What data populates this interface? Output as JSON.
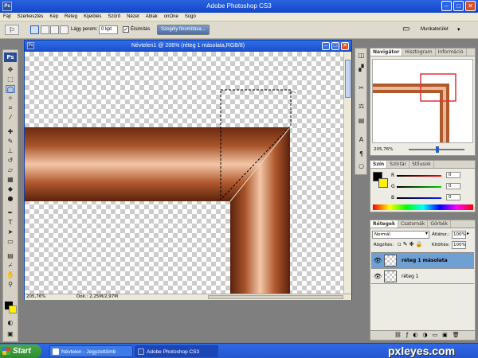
{
  "app": {
    "title": "Adobe Photoshop CS3",
    "ps_badge": "Ps"
  },
  "menu": [
    "Fájl",
    "Szerkesztés",
    "Kép",
    "Réteg",
    "Kijelölés",
    "Szűrő",
    "Nézet",
    "Ablak",
    "onOne",
    "Súgó"
  ],
  "options": {
    "feather_label": "Lágy perem:",
    "feather_value": "0 kpt",
    "antialias_label": "Élsimítás",
    "refine_button": "Szegély finomítása...",
    "workspace_label": "Munkaterület"
  },
  "document": {
    "title": "Névtelen1 @ 206% (réteg 1 másolata,RGB/8)",
    "zoom": "205,76%",
    "doc_info": "Dok.: 2,25M/2,97M"
  },
  "navigator": {
    "tabs": [
      "Navigátor",
      "Hisztogram",
      "Információ"
    ],
    "zoom": "205,76%"
  },
  "color_panel": {
    "tabs": [
      "Szín",
      "Színtár",
      "Stílusok"
    ],
    "channels": [
      {
        "label": "R",
        "value": "0",
        "color": "#d62222"
      },
      {
        "label": "G",
        "value": "0",
        "color": "#22b022"
      },
      {
        "label": "B",
        "value": "0",
        "color": "#2233cc"
      }
    ],
    "foreground_color": "#000000",
    "background_color": "#fff200"
  },
  "layers": {
    "tabs": [
      "Rétegek",
      "Csatornák",
      "Görbék"
    ],
    "blend_mode": "Normál",
    "opacity_label": "Átlátsz.:",
    "opacity_value": "100%",
    "lock_label": "Rögzítés:",
    "fill_label": "Kitöltés:",
    "fill_value": "100%",
    "items": [
      {
        "name": "réteg 1 másolata",
        "selected": true
      },
      {
        "name": "réteg 1",
        "selected": false
      }
    ]
  },
  "taskbar": {
    "start": "Start",
    "items": [
      "Névtelen - Jegyzettömb",
      "Adobe Photoshop CS3"
    ]
  },
  "watermark": "pxleyes.com",
  "colors": {
    "accent": "#1d52d6",
    "pipe_copper": "#a5512a",
    "selection_layer": "#6fa0d4"
  }
}
